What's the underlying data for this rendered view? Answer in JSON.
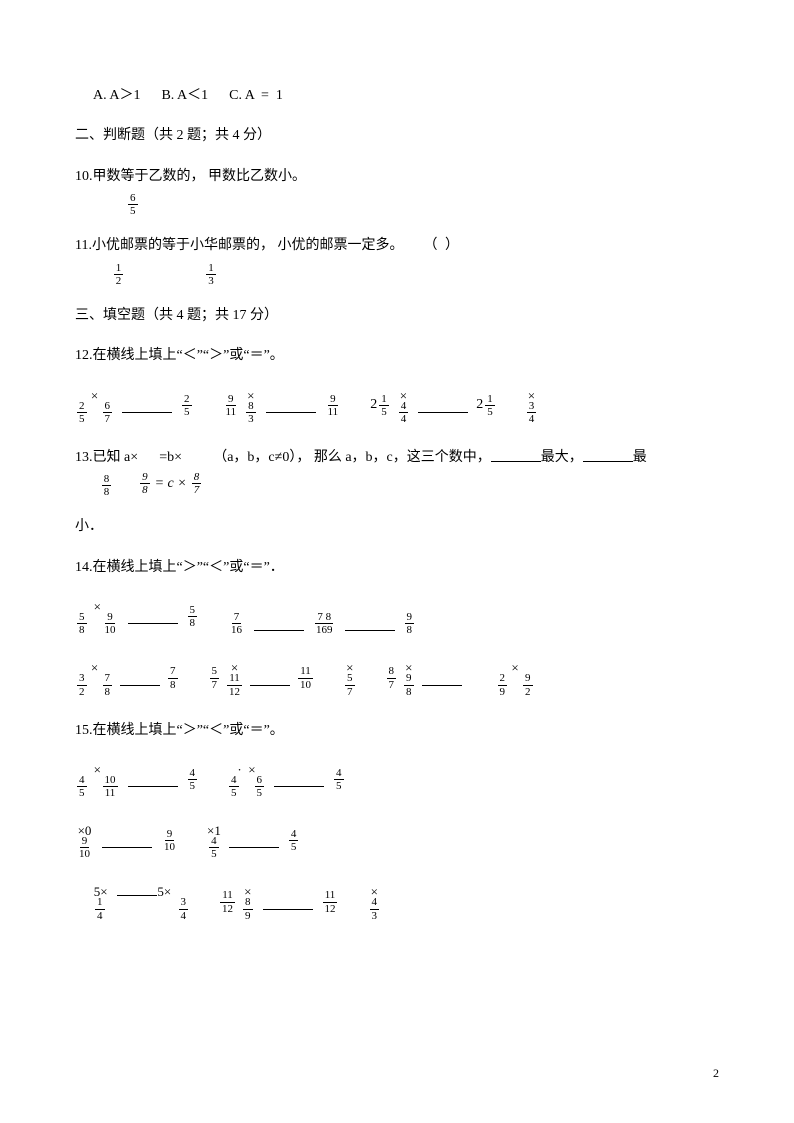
{
  "q9": {
    "indent": true,
    "opts": "A. A＞1      B. A＜1      C. A  =  1"
  },
  "sec2": "二、判断题（共 2 题；共 4 分）",
  "q10": {
    "pre": "10.甲数等于乙数的",
    "frac": {
      "n": "6",
      "d": "5"
    },
    "post": "， 甲数比乙数小。"
  },
  "q11": {
    "pre": "11.小优邮票的",
    "f1": {
      "n": "1",
      "d": "2"
    },
    "mid": "等于小华邮票的",
    "f2": {
      "n": "1",
      "d": "3"
    },
    "post": "， 小优的邮票一定多。",
    "paren": "（       ）"
  },
  "sec3": "三、填空题（共 4 题；共 17 分）",
  "q12": {
    "title": "12.在横线上填上“＜”“＞”或“＝”。",
    "row": [
      {
        "f1": {
          "n": "2",
          "d": "5"
        },
        "op": "×",
        "f2": {
          "n": "6",
          "d": "7"
        },
        "blank": true,
        "f3": {
          "n": "2",
          "d": "5"
        }
      },
      {
        "f1": {
          "n": "9",
          "d": "11"
        },
        "op": "×",
        "f2": {
          "n": "8",
          "d": "3"
        },
        "blank": true,
        "f3": {
          "n": "9",
          "d": "11"
        }
      },
      {
        "mixed": "2",
        "f1": {
          "n": "1",
          "d": "5"
        },
        "op": "×",
        "f2": {
          "n": "4",
          "d": "4"
        },
        "blank": true,
        "mixed2": "2",
        "f3": {
          "n": "1",
          "d": "5"
        }
      },
      {
        "op": "×",
        "f2": {
          "n": "3",
          "d": "4"
        }
      }
    ]
  },
  "q13": {
    "pre": "13.已知 a×",
    "f1": {
      "n": "8",
      "d": "8"
    },
    "mid1": "=b×",
    "eq": {
      "f2": {
        "n": "9",
        "d": "8"
      },
      "txt": "= c ×",
      "f3": {
        "n": "8",
        "d": "7"
      }
    },
    "mid2": "（a，b，c≠0）， 那么 a，b，c，这三个数中，",
    "mid3": "最大，",
    "mid4": "最",
    "line2": "小．"
  },
  "q14": {
    "title": "14.在横线上填上“＞”“＜”或“＝”．",
    "row1": [
      {
        "f1": {
          "n": "5",
          "d": "8"
        },
        "op": "×",
        "f2": {
          "n": "9",
          "d": "10"
        },
        "blank": true,
        "f3": {
          "n": "5",
          "d": "8"
        }
      },
      {
        "f1": {
          "n": "7",
          "d": "16"
        },
        "blank": true,
        "f2": {
          "n": "7 8",
          "d": "169"
        },
        "blank2": true,
        "f3": {
          "n": "9",
          "d": "8"
        }
      }
    ],
    "row2": [
      {
        "f1": {
          "n": "3",
          "d": "2"
        },
        "op": "×",
        "f2": {
          "n": "7",
          "d": "8"
        },
        "blank": true,
        "f3": {
          "n": "7",
          "d": "8"
        }
      },
      {
        "f1": {
          "n": "5",
          "d": "7"
        },
        "op": "×",
        "f2": {
          "n": "11",
          "d": "12"
        },
        "blank": true,
        "f3": {
          "n": "11",
          "d": "10"
        }
      },
      {
        "op": "×",
        "f2": {
          "n": "5",
          "d": "7"
        }
      },
      {
        "f1": {
          "n": "8",
          "d": "7"
        },
        "op": "×",
        "f2": {
          "n": "9",
          "d": "8"
        },
        "blank": true
      },
      {
        "f1": {
          "n": "2",
          "d": "9"
        },
        "op": "×",
        "f2": {
          "n": "9",
          "d": "2"
        }
      }
    ]
  },
  "q15": {
    "title": "15.在横线上填上“＞”“＜”或“＝”。",
    "row1": [
      {
        "f1": {
          "n": "4",
          "d": "5"
        },
        "op": "×",
        "f2": {
          "n": "10",
          "d": "11"
        },
        "blank": true,
        "f3": {
          "n": "4",
          "d": "5"
        }
      },
      {
        "dot": "·",
        "f1": {
          "n": "4",
          "d": "5"
        },
        "op": "×",
        "f2": {
          "n": "6",
          "d": "5"
        },
        "blank": true,
        "f3": {
          "n": "4",
          "d": "5"
        }
      }
    ],
    "row2": [
      {
        "f1": {
          "n": "9",
          "d": "10"
        },
        "op": "×0",
        "blank": true,
        "f2": {
          "n": "9",
          "d": "10"
        }
      },
      {
        "f1": {
          "n": "4",
          "d": "5"
        },
        "op": "×1",
        "blank": true,
        "f2": {
          "n": "4",
          "d": "5"
        }
      }
    ],
    "row3": [
      {
        "pre": "5×",
        "f1": {
          "n": "1",
          "d": "4"
        },
        "blank": true,
        "post": "5×",
        "f2": {
          "n": "3",
          "d": "4"
        }
      },
      {
        "f1": {
          "n": "11",
          "d": "12"
        },
        "op": "×",
        "f2": {
          "n": "8",
          "d": "9"
        },
        "blank": true,
        "f3": {
          "n": "11",
          "d": "12"
        }
      },
      {
        "op": "×",
        "f2": {
          "n": "4",
          "d": "3"
        }
      }
    ]
  },
  "pagenum": "2"
}
